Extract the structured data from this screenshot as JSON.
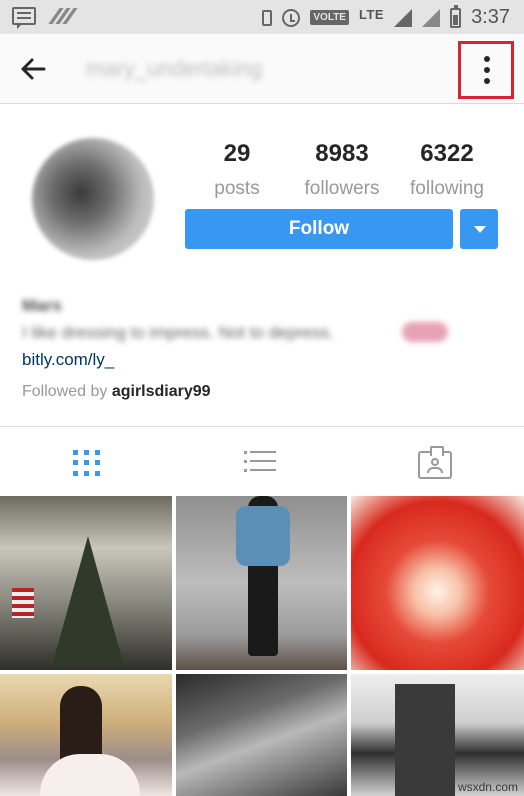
{
  "status_bar": {
    "time": "3:37",
    "network": "LTE",
    "volte": "VOLTE"
  },
  "app_bar": {
    "username": "mary_undertaking"
  },
  "profile": {
    "stats": [
      {
        "value": "29",
        "label": "posts"
      },
      {
        "value": "8983",
        "label": "followers"
      },
      {
        "value": "6322",
        "label": "following"
      }
    ],
    "follow_label": "Follow",
    "name": "Mars",
    "bio": "I like dressing to impress. Not to depress.",
    "link": "bitly.com/ly_",
    "followed_by_prefix": "Followed by",
    "followed_by_user": "agirlsdiary99"
  },
  "tabs": [
    {
      "icon": "grid-icon",
      "active": true
    },
    {
      "icon": "list-icon",
      "active": false
    },
    {
      "icon": "tagged-icon",
      "active": false
    }
  ],
  "colors": {
    "accent": "#3897f0",
    "highlight_box": "#d8242f"
  },
  "watermark": "wsxdn.com"
}
